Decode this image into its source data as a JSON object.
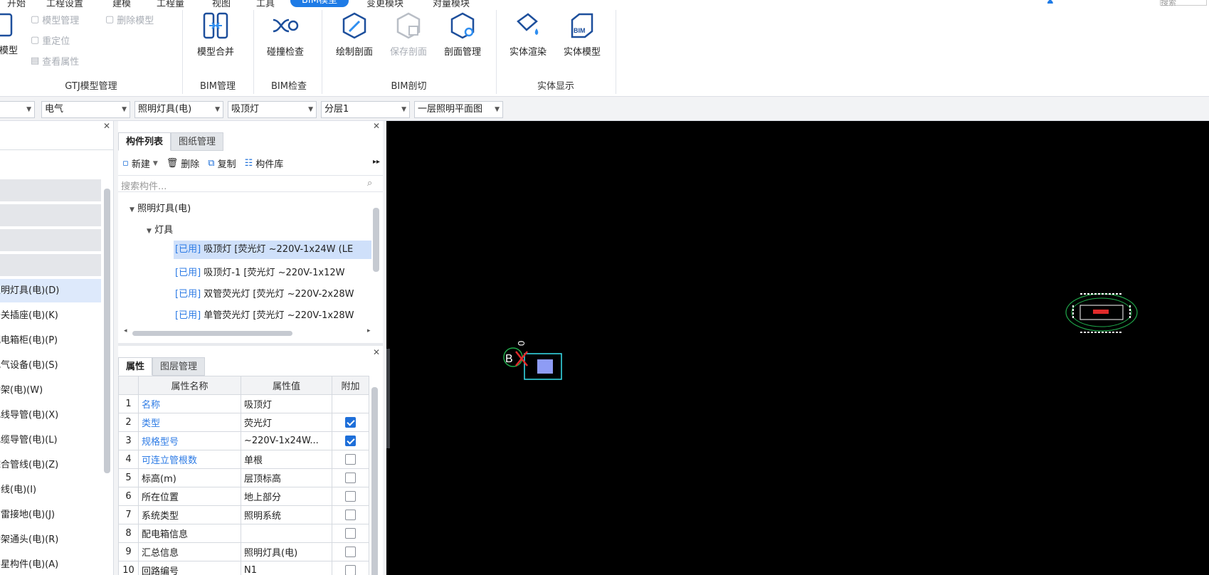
{
  "menubar": {
    "items": [
      "开始",
      "工程设置",
      "建模",
      "工程量",
      "视图",
      "工具",
      "BIM模型",
      "变更模块",
      "对量模块"
    ],
    "active": "BIM模型",
    "search_placeholder": "搜索"
  },
  "ribbon": {
    "model_label": "模型",
    "small_buttons": [
      "模型管理",
      "删除模型",
      "重定位",
      "查看属性"
    ],
    "merge": "模型合并",
    "collision": "碰撞检查",
    "draw_section": "绘制剖面",
    "save_section": "保存剖面",
    "section_mgmt": "剖面管理",
    "render": "实体渲染",
    "solid_model": "实体模型",
    "groups": [
      "GTJ模型管理",
      "BIM管理",
      "BIM检查",
      "BIM剖切",
      "实体显示"
    ]
  },
  "filters": [
    "",
    "电气",
    "照明灯具(电)",
    "吸顶灯",
    "分层1",
    "一层照明平面图"
  ],
  "leftnav": {
    "items": [
      "照明灯具(电)(D)",
      "开关插座(电)(K)",
      "配电箱柜(电)(P)",
      "电气设备(电)(S)",
      "桥架(电)(W)",
      "电线导管(电)(X)",
      "电缆导管(电)(L)",
      "综合管线(电)(Z)",
      "母线(电)(I)",
      "防雷接地(电)(J)",
      "桥架通头(电)(R)",
      "零星构件(电)(A)"
    ]
  },
  "component_panel": {
    "tabs": [
      "构件列表",
      "图纸管理"
    ],
    "new": "新建",
    "delete": "删除",
    "copy": "复制",
    "library": "构件库",
    "search_placeholder": "搜索构件...",
    "tree_root": "照明灯具(电)",
    "tree_group": "灯具",
    "used_tag": "[已用]",
    "items": [
      "吸顶灯 [荧光灯 ~220V-1x24W (LE",
      "吸顶灯-1 [荧光灯 ~220V-1x12W",
      "双管荧光灯 [荧光灯 ~220V-2x28W",
      "单管荧光灯 [荧光灯 ~220V-1x28W"
    ]
  },
  "prop_panel": {
    "tabs": [
      "属性",
      "图层管理"
    ],
    "headers": [
      "属性名称",
      "属性值",
      "附加"
    ],
    "rows": [
      {
        "no": "1",
        "name": "名称",
        "value": "吸顶灯",
        "link": true,
        "cb": "none"
      },
      {
        "no": "2",
        "name": "类型",
        "value": "荧光灯",
        "link": true,
        "cb": "on"
      },
      {
        "no": "3",
        "name": "规格型号",
        "value": "~220V-1x24W...",
        "link": true,
        "cb": "on"
      },
      {
        "no": "4",
        "name": "可连立管根数",
        "value": "单根",
        "link": true,
        "cb": "off"
      },
      {
        "no": "5",
        "name": "标高(m)",
        "value": "层顶标高",
        "link": false,
        "cb": "off"
      },
      {
        "no": "6",
        "name": "所在位置",
        "value": "地上部分",
        "link": false,
        "cb": "off"
      },
      {
        "no": "7",
        "name": "系统类型",
        "value": "照明系统",
        "link": false,
        "cb": "off"
      },
      {
        "no": "8",
        "name": "配电箱信息",
        "value": "",
        "link": false,
        "cb": "off"
      },
      {
        "no": "9",
        "name": "汇总信息",
        "value": "照明灯具(电)",
        "link": false,
        "cb": "off"
      },
      {
        "no": "10",
        "name": "回路编号",
        "value": "N1",
        "link": false,
        "cb": "off"
      }
    ]
  }
}
